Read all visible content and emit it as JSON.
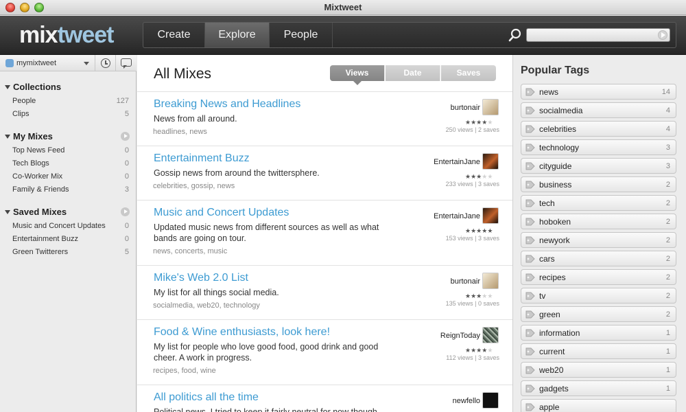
{
  "window": {
    "title": "Mixtweet"
  },
  "header": {
    "logo_mix": "mix",
    "logo_tweet": "tweet",
    "nav": [
      {
        "label": "Create",
        "active": false
      },
      {
        "label": "Explore",
        "active": true
      },
      {
        "label": "People",
        "active": false
      }
    ],
    "search": {
      "value": "",
      "placeholder": ""
    }
  },
  "sidebar": {
    "account": "mymixtweet",
    "sections": [
      {
        "title": "Collections",
        "items": [
          {
            "label": "People",
            "count": "127"
          },
          {
            "label": "Clips",
            "count": "5"
          }
        ]
      },
      {
        "title": "My Mixes",
        "items": [
          {
            "label": "Top News Feed",
            "count": "0"
          },
          {
            "label": "Tech Blogs",
            "count": "0"
          },
          {
            "label": "Co-Worker Mix",
            "count": "0"
          },
          {
            "label": "Family & Friends",
            "count": "3"
          }
        ]
      },
      {
        "title": "Saved Mixes",
        "items": [
          {
            "label": "Music and Concert Updates",
            "count": "0"
          },
          {
            "label": "Entertainment Buzz",
            "count": "0"
          },
          {
            "label": "Green Twitterers",
            "count": "5"
          }
        ]
      }
    ]
  },
  "main": {
    "title": "All Mixes",
    "sort": [
      {
        "label": "Views",
        "active": true
      },
      {
        "label": "Date",
        "active": false
      },
      {
        "label": "Saves",
        "active": false
      }
    ],
    "mixes": [
      {
        "title": "Breaking News and Headlines",
        "desc": "News from all around.",
        "tags": "headlines, news",
        "author": "burtonair",
        "rating": 4.5,
        "stats": "250 views | 2 saves",
        "avatar_color": "#cbb48f"
      },
      {
        "title": "Entertainment Buzz",
        "desc": "Gossip news from around the twittersphere.",
        "tags": "celebrities, gossip, news",
        "author": "EntertainJane",
        "rating": 3,
        "stats": "233 views | 3 saves",
        "avatar_color": "#7a3a1e"
      },
      {
        "title": "Music and Concert Updates",
        "desc": "Updated music news from different sources as well as what bands are going on tour.",
        "tags": "news, concerts, music",
        "author": "EntertainJane",
        "rating": 5,
        "stats": "153 views | 3 saves",
        "avatar_color": "#7a3a1e"
      },
      {
        "title": "Mike's Web 2.0 List",
        "desc": "My list for all things social media.",
        "tags": "socialmedia, web20, technology",
        "author": "burtonair",
        "rating": 3.5,
        "stats": "135 views | 0 saves",
        "avatar_color": "#cbb48f"
      },
      {
        "title": "Food & Wine enthusiasts, look here!",
        "desc": "My list for people who love good food, good drink and good cheer. A work in progress.",
        "tags": "recipes, food, wine",
        "author": "ReignToday",
        "rating": 4,
        "stats": "112 views | 3 saves",
        "avatar_color": "#6e7d70"
      },
      {
        "title": "All politics all the time",
        "desc": "Political news. I tried to keep it fairly neutral for now though.",
        "tags": "",
        "author": "newfello",
        "rating": 0,
        "stats": "",
        "avatar_color": "#111111"
      }
    ]
  },
  "popular_tags": {
    "title": "Popular Tags",
    "tags": [
      {
        "name": "news",
        "count": "14"
      },
      {
        "name": "socialmedia",
        "count": "4"
      },
      {
        "name": "celebrities",
        "count": "4"
      },
      {
        "name": "technology",
        "count": "3"
      },
      {
        "name": "cityguide",
        "count": "3"
      },
      {
        "name": "business",
        "count": "2"
      },
      {
        "name": "tech",
        "count": "2"
      },
      {
        "name": "hoboken",
        "count": "2"
      },
      {
        "name": "newyork",
        "count": "2"
      },
      {
        "name": "cars",
        "count": "2"
      },
      {
        "name": "recipes",
        "count": "2"
      },
      {
        "name": "tv",
        "count": "2"
      },
      {
        "name": "green",
        "count": "2"
      },
      {
        "name": "information",
        "count": "1"
      },
      {
        "name": "current",
        "count": "1"
      },
      {
        "name": "web20",
        "count": "1"
      },
      {
        "name": "gadgets",
        "count": "1"
      },
      {
        "name": "apple",
        "count": ""
      }
    ]
  },
  "colors": {
    "link": "#3d9bd2",
    "header_dark": "#2a2a2a",
    "logo_accent": "#9fc6e0"
  },
  "icons": [
    "search-icon",
    "clock-icon",
    "chat-bubble-icon",
    "tag-icon",
    "play-icon",
    "twitter-bird-icon"
  ]
}
